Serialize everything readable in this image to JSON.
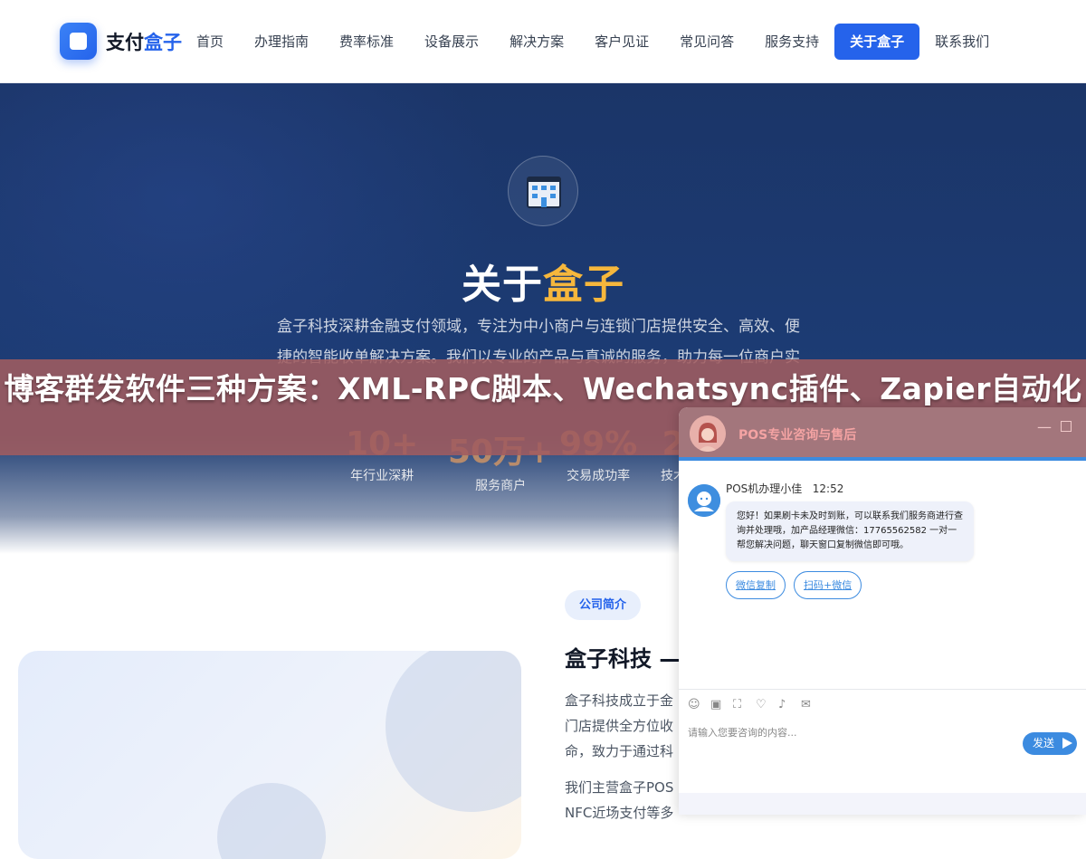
{
  "header": {
    "logo_text_a": "支付",
    "logo_text_b": "盒子",
    "nav": [
      "首页",
      "办理指南",
      "费率标准",
      "设备展示",
      "解决方案",
      "客户见证",
      "常见问答",
      "服务支持",
      "关于盒子",
      "联系我们"
    ],
    "active_index": 8
  },
  "hero": {
    "title_a": "关于",
    "title_b": "盒子",
    "desc": "盒子科技深耕金融支付领域，专注为中小商户与连锁门店提供安全、高效、便捷的智能收单解决方案。我们以专业的产品与真诚的服务，助力每一位商户实现生",
    "stats": [
      {
        "value": "10+",
        "label": "年行业深耕"
      },
      {
        "value": "50万+",
        "label": "服务商户"
      },
      {
        "value": "99%",
        "label": "交易成功率"
      },
      {
        "value": "2",
        "label": "技术"
      }
    ]
  },
  "banner": {
    "text": "博客群发软件三种方案：XML-RPC脚本、Wechatsync插件、Zapier自动化"
  },
  "intro": {
    "tag": "公司简介",
    "title": "盒子科技 —",
    "p1": "盒子科技成立于金",
    "p1b": "门店提供全方位收",
    "p1c": "命，致力于通过科",
    "p2": "我们主营盒子POS",
    "p2b": "NFC近场支付等多"
  },
  "chat": {
    "title": "POS专业咨询与售后",
    "agent_name": "POS机办理小佳",
    "time": "12:52",
    "message": "您好！如果刷卡未及时到账，可以联系我们服务商进行查询并处理哦，加产品经理微信：17765562582 一对一帮您解决问题，聊天窗口复制微信即可哦。",
    "quick_replies": [
      "微信复制",
      "扫码+微信"
    ],
    "input_placeholder": "请输入您要咨询的内容...",
    "send_label": "发送",
    "accent": "#3c8be0"
  }
}
